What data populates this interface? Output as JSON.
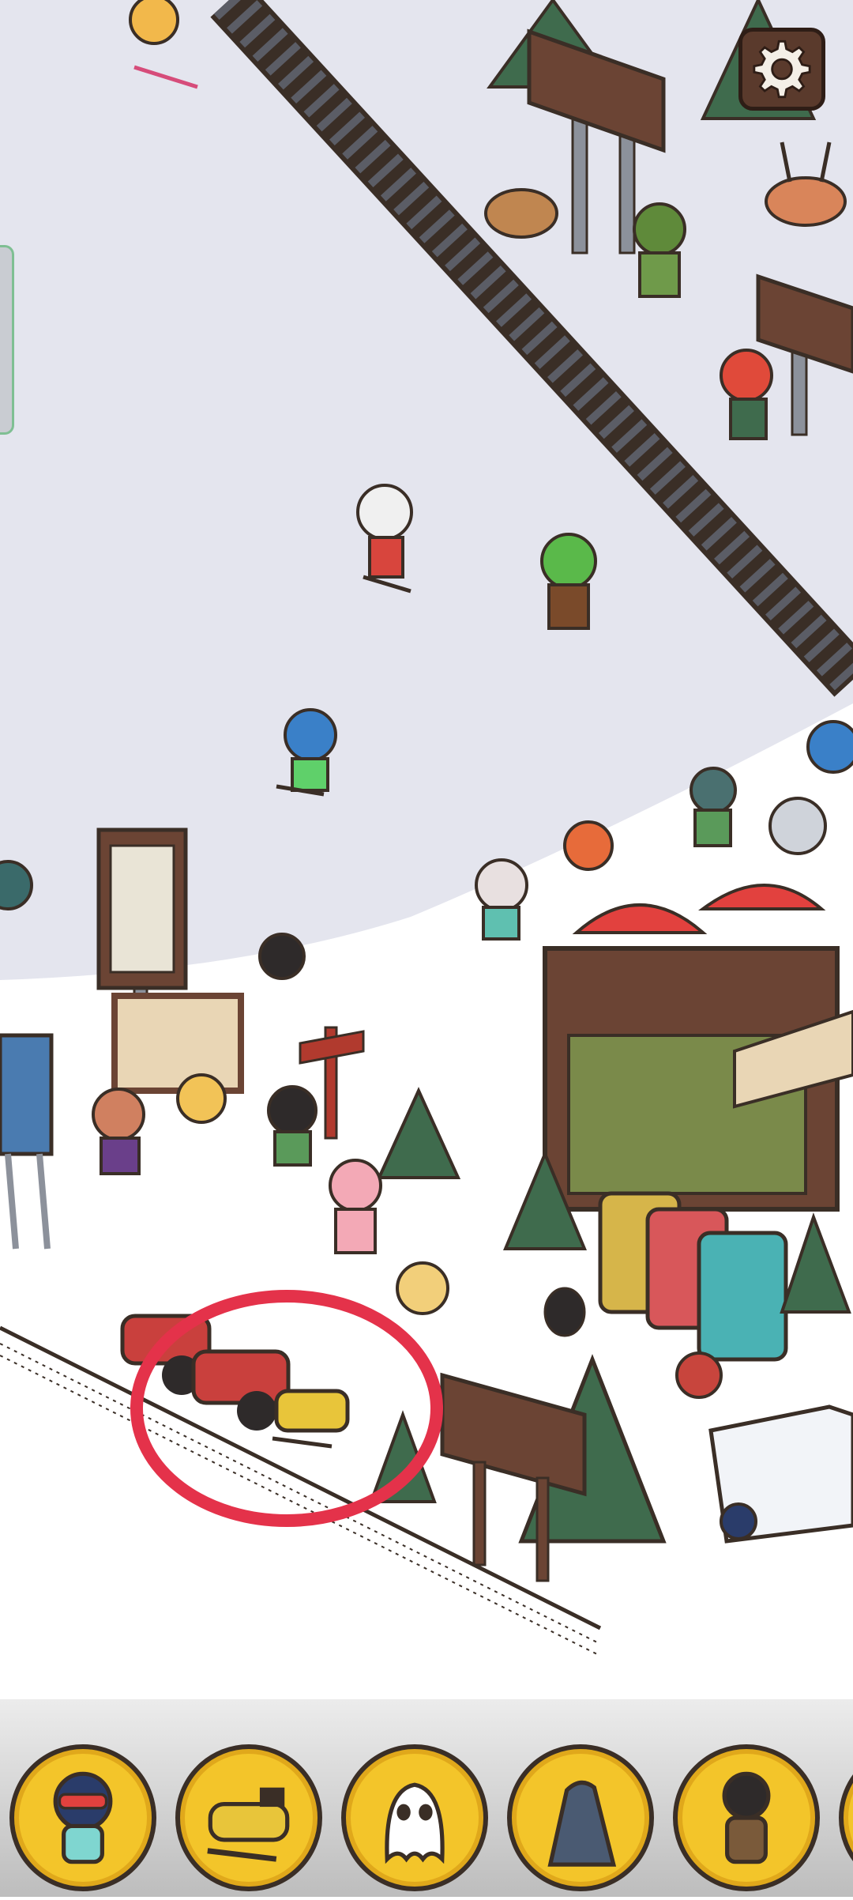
{
  "game": {
    "scene_name": "ski-resort",
    "colors": {
      "slope_snow": "#e4e5ee",
      "snow_white": "#ffffff",
      "outline": "#3a2e26",
      "highlight_ring": "#e4324a",
      "slot_yellow": "#f3c52a",
      "tray_bg": "#d8d8d8"
    },
    "settings": {
      "icon": "gear-icon"
    },
    "highlight": {
      "target": "snowmobile",
      "shape": "ellipse"
    },
    "item_tray": [
      {
        "icon": "skier-goggles-character-icon"
      },
      {
        "icon": "snowmobile-icon"
      },
      {
        "icon": "ghost-panda-icon"
      },
      {
        "icon": "rock-icon"
      },
      {
        "icon": "bundled-character-icon"
      },
      {
        "icon": "partial-item-icon"
      }
    ]
  }
}
